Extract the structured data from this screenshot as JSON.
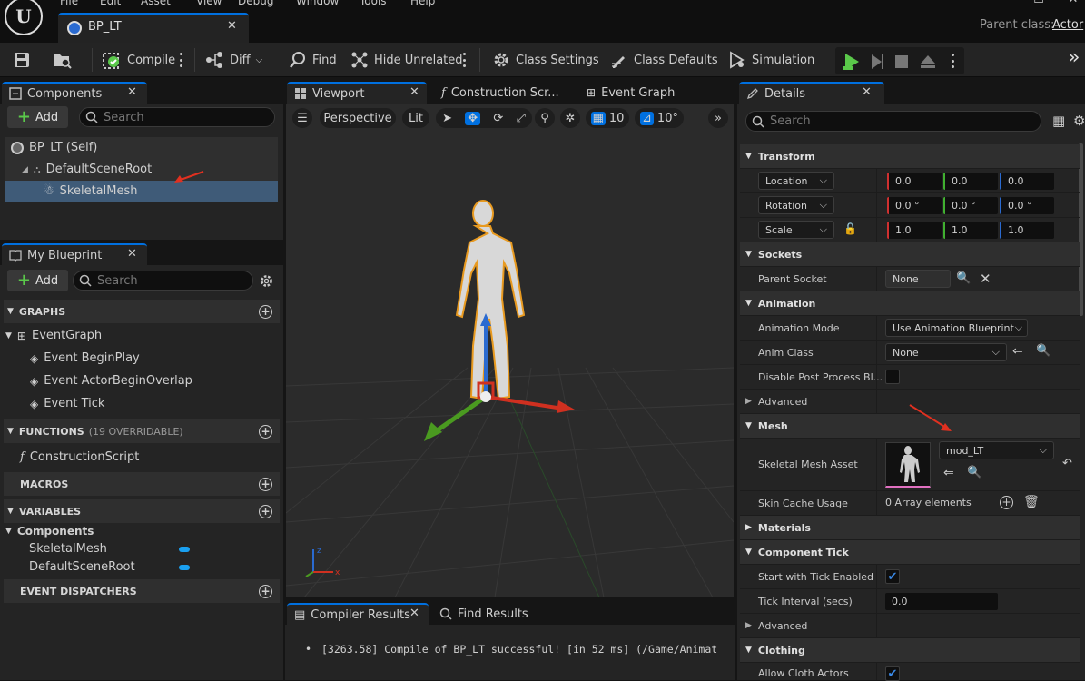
{
  "menu": [
    "File",
    "Edit",
    "Asset",
    "View",
    "Debug",
    "Window",
    "Tools",
    "Help"
  ],
  "document_tab": {
    "title": "BP_LT"
  },
  "parent_class": {
    "label": "Parent class:",
    "value": "Actor"
  },
  "toolbar": {
    "compile": "Compile",
    "diff": "Diff",
    "find": "Find",
    "hide_unrelated": "Hide Unrelated",
    "class_settings": "Class Settings",
    "class_defaults": "Class Defaults",
    "simulation": "Simulation"
  },
  "components_panel": {
    "tab": "Components",
    "add": "Add",
    "search_placeholder": "Search",
    "tree": [
      {
        "label": "BP_LT (Self)"
      },
      {
        "label": "DefaultSceneRoot"
      },
      {
        "label": "SkeletalMesh"
      }
    ]
  },
  "my_blueprint": {
    "tab": "My Blueprint",
    "add": "Add",
    "search_placeholder": "Search",
    "graphs_header": "GRAPHS",
    "event_graph": "EventGraph",
    "events": [
      "Event BeginPlay",
      "Event ActorBeginOverlap",
      "Event Tick"
    ],
    "functions_header": "FUNCTIONS",
    "functions_count": "(19 OVERRIDABLE)",
    "construction_script": "ConstructionScript",
    "macros_header": "MACROS",
    "variables_header": "VARIABLES",
    "components_category": "Components",
    "variables": [
      "SkeletalMesh",
      "DefaultSceneRoot"
    ],
    "dispatchers_header": "EVENT DISPATCHERS"
  },
  "center_tabs": {
    "viewport": "Viewport",
    "construction": "Construction Scr...",
    "event_graph": "Event Graph"
  },
  "viewport_toolbar": {
    "perspective": "Perspective",
    "lit": "Lit",
    "grid_snap": "10",
    "rot_snap": "10°"
  },
  "bottom_tabs": {
    "compiler_results": "Compiler Results",
    "find_results": "Find Results"
  },
  "compiler_message": "[3263.58] Compile of BP_LT successful! [in 52 ms] (/Game/Animat",
  "details": {
    "tab": "Details",
    "search_placeholder": "Search",
    "transform": "Transform",
    "location": {
      "label": "Location",
      "x": "0.0",
      "y": "0.0",
      "z": "0.0"
    },
    "rotation": {
      "label": "Rotation",
      "x": "0.0 °",
      "y": "0.0 °",
      "z": "0.0 °"
    },
    "scale": {
      "label": "Scale",
      "x": "1.0",
      "y": "1.0",
      "z": "1.0"
    },
    "sockets": "Sockets",
    "parent_socket_label": "Parent Socket",
    "parent_socket_value": "None",
    "animation": "Animation",
    "animation_mode_label": "Animation Mode",
    "animation_mode_value": "Use Animation Blueprint",
    "anim_class_label": "Anim Class",
    "anim_class_value": "None",
    "disable_pp_label": "Disable Post Process Bl...",
    "advanced": "Advanced",
    "mesh": "Mesh",
    "skeletal_mesh_asset_label": "Skeletal Mesh Asset",
    "skeletal_mesh_asset_value": "mod_LT",
    "skin_cache_label": "Skin Cache Usage",
    "skin_cache_value": "0 Array elements",
    "materials": "Materials",
    "component_tick": "Component Tick",
    "start_tick_label": "Start with Tick Enabled",
    "tick_interval_label": "Tick Interval (secs)",
    "tick_interval_value": "0.0",
    "advanced2": "Advanced",
    "clothing": "Clothing",
    "allow_cloth_label": "Allow Cloth Actors"
  },
  "colors": {
    "accent": "#0070e0",
    "annotation_arrow": "#e03020",
    "compile_ok": "#5ac84a",
    "variable_pill": "#1aa0f0"
  }
}
